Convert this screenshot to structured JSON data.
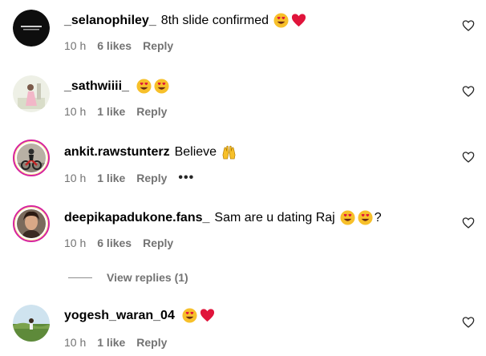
{
  "comments": [
    {
      "username": "_selanophiley_",
      "text": "8th slide confirmed",
      "emojis": [
        "heart-eyes",
        "red-heart"
      ],
      "time": "10 h",
      "likes": "6 likes",
      "reply": "Reply",
      "avatar": "dark-text-avatar"
    },
    {
      "username": "_sathwiiii_",
      "text": "",
      "emojis": [
        "heart-eyes",
        "heart-eyes"
      ],
      "time": "10 h",
      "likes": "1 like",
      "reply": "Reply",
      "avatar": "pink-person-avatar"
    },
    {
      "username": "ankit.rawstunterz",
      "text": "Believe",
      "emojis": [
        "raising-hands"
      ],
      "time": "10 h",
      "likes": "1 like",
      "reply": "Reply",
      "more": "•••",
      "avatar": "stunt-bike-avatar"
    },
    {
      "username": "deepikapadukone.fans_",
      "text": "Sam are u dating Raj",
      "emojis": [
        "heart-eyes",
        "heart-eyes"
      ],
      "suffix": "?",
      "time": "10 h",
      "likes": "6 likes",
      "reply": "Reply",
      "avatar": "woman-portrait-avatar"
    },
    {
      "username": "yogesh_waran_04",
      "text": "",
      "emojis": [
        "heart-eyes",
        "red-heart"
      ],
      "time": "10 h",
      "likes": "1 like",
      "reply": "Reply",
      "avatar": "field-landscape-avatar"
    }
  ],
  "view_replies": "View replies (1)",
  "colors": {
    "meta_gray": "#737373",
    "emoji_yellow": "#f7c02a",
    "heart_red": "#e0143b",
    "story_ring": "#d6249f"
  }
}
